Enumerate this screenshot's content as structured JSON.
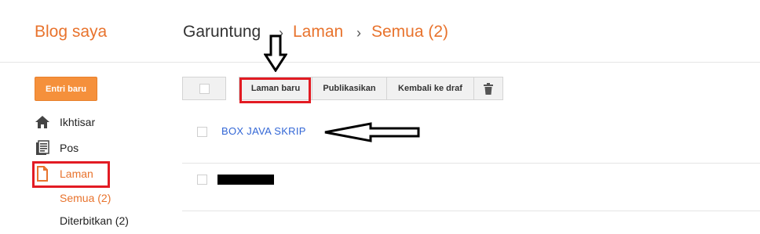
{
  "header": {
    "blog_link": "Blog saya",
    "breadcrumb": {
      "blog_name": "Garuntung",
      "separator": "›",
      "section": "Laman",
      "filter": "Semua (2)"
    }
  },
  "sidebar": {
    "new_post_label": "Entri baru",
    "items": [
      {
        "label": "Ikhtisar",
        "icon": "home-icon"
      },
      {
        "label": "Pos",
        "icon": "posts-icon"
      },
      {
        "label": "Laman",
        "icon": "page-icon"
      }
    ],
    "sub_items": [
      {
        "label": "Semua (2)"
      },
      {
        "label": "Diterbitkan (2)"
      }
    ]
  },
  "toolbar": {
    "new_page_label": "Laman baru",
    "publish_label": "Publikasikan",
    "revert_label": "Kembali ke draf",
    "delete_icon": "trash-icon"
  },
  "pages": [
    {
      "title": "BOX JAVA SKRIP"
    },
    {
      "title": "",
      "redacted": true
    }
  ],
  "colors": {
    "accent": "#e8732d",
    "button": "#f5903b",
    "link": "#3367d6",
    "annotation_red": "#e21b23"
  }
}
